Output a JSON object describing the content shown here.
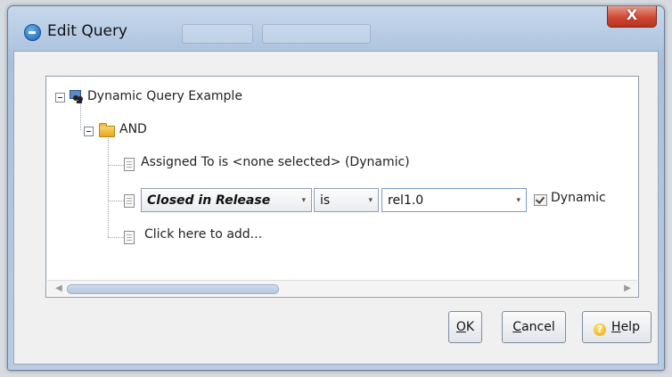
{
  "window": {
    "title": "Edit Query",
    "close_label": "X"
  },
  "tree": {
    "root_label": "Dynamic Query Example",
    "group_label": "AND",
    "condition1": "Assigned To is <none selected> (Dynamic)",
    "condition2": {
      "field": "Closed in Release",
      "operator": "is",
      "value": "rel1.0",
      "dynamic_label": "Dynamic"
    },
    "add_label": "Click here to add..."
  },
  "buttons": {
    "ok_prefix": "",
    "ok_mnemonic": "O",
    "ok_rest": "K",
    "cancel_mnemonic": "C",
    "cancel_rest": "ancel",
    "help_mnemonic": "H",
    "help_rest": "elp"
  },
  "icons": {
    "window": "app-icon",
    "root": "query-icon",
    "group": "folder-icon",
    "condition": "document-icon",
    "help": "help-icon"
  }
}
